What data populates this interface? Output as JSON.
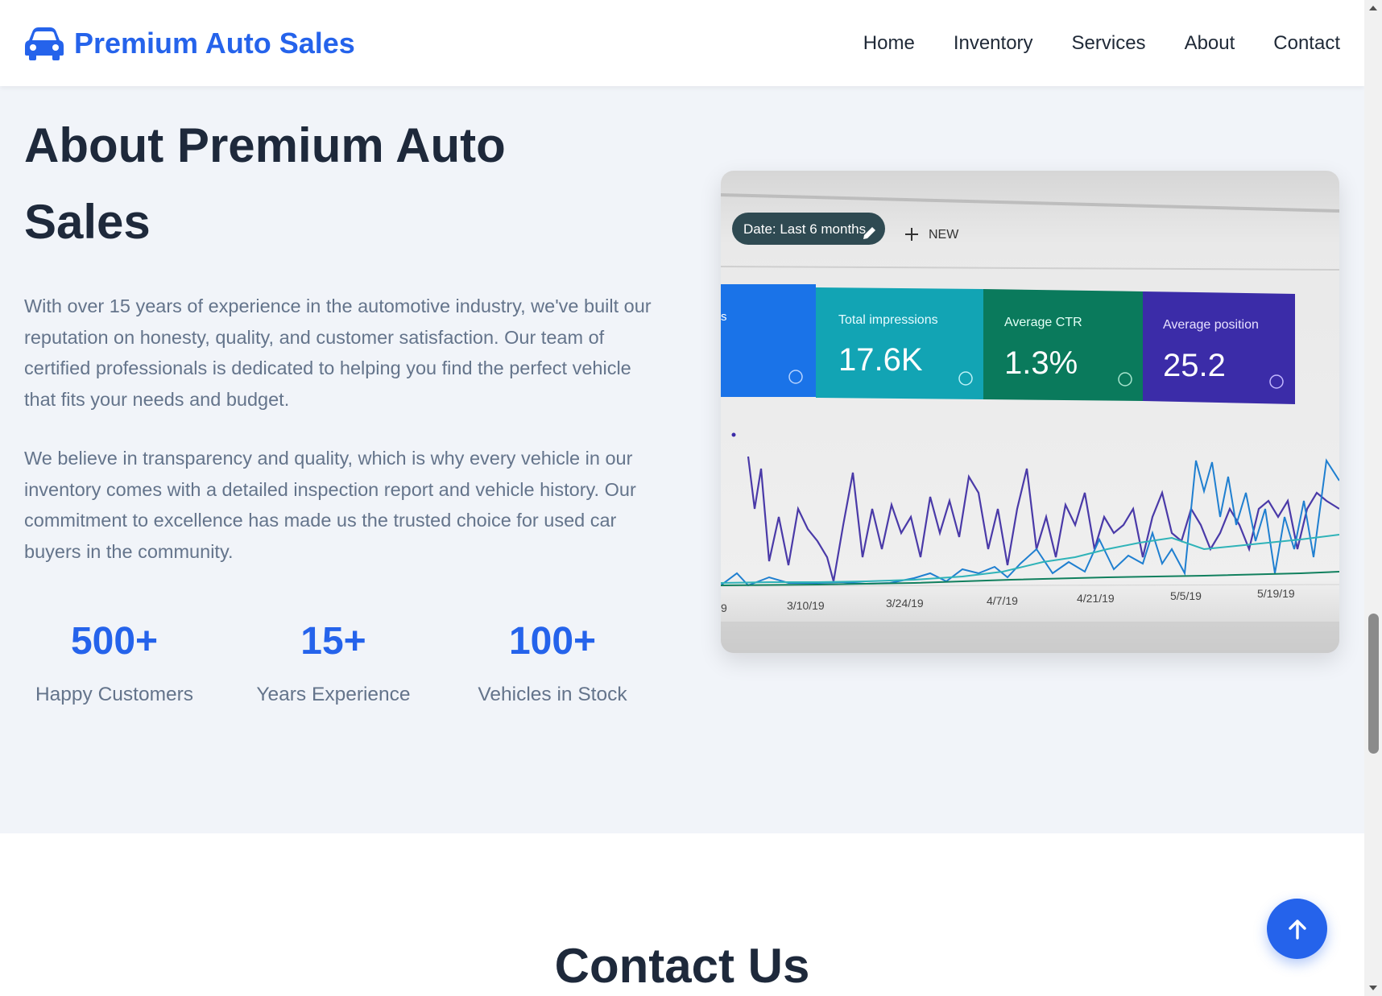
{
  "header": {
    "brand_icon": "car-icon",
    "brand_name": "Premium Auto Sales",
    "nav": [
      "Home",
      "Inventory",
      "Services",
      "About",
      "Contact"
    ]
  },
  "about": {
    "title": "About Premium Auto Sales",
    "paragraphs": [
      "With over 15 years of experience in the automotive industry, we've built our reputation on honesty, quality, and customer satisfaction. Our team of certified professionals is dedicated to helping you find the perfect vehicle that fits your needs and budget.",
      "We believe in transparency and quality, which is why every vehicle in our inventory comes with a detailed inspection report and vehicle history. Our commitment to excellence has made us the trusted choice for used car buyers in the community."
    ],
    "stats": [
      {
        "number": "500+",
        "label": "Happy Customers"
      },
      {
        "number": "15+",
        "label": "Years Experience"
      },
      {
        "number": "100+",
        "label": "Vehicles in Stock"
      }
    ],
    "image": {
      "filter_chip": "Date: Last 6 months",
      "new_button": "NEW",
      "first_tile_partial": "s",
      "metrics": [
        {
          "label": "Total impressions",
          "value": "17.6K"
        },
        {
          "label": "Average CTR",
          "value": "1.3%"
        },
        {
          "label": "Average position",
          "value": "25.2"
        }
      ],
      "x_ticks": [
        "9",
        "3/10/19",
        "3/24/19",
        "4/7/19",
        "4/21/19",
        "5/5/19",
        "5/19/19"
      ]
    }
  },
  "contact": {
    "title": "Contact Us"
  },
  "back_to_top_icon": "arrow-up-icon",
  "colors": {
    "brand": "#2563eb",
    "heading": "#1e293b",
    "body_text": "#64748b",
    "section_bg": "#f1f4f9"
  }
}
